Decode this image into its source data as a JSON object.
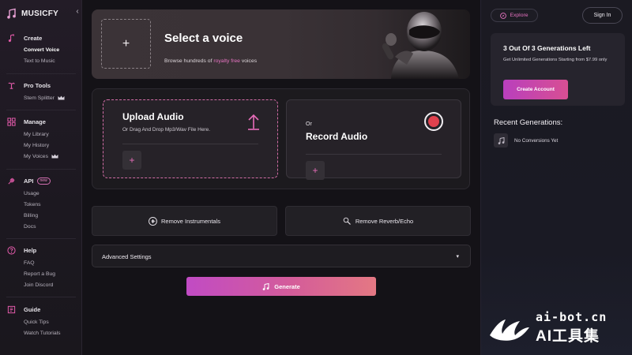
{
  "brand": {
    "name": "MUSICFY",
    "collapse_glyph": "‹"
  },
  "sidebar": {
    "create": {
      "title": "Create",
      "items": [
        {
          "label": "Convert Voice",
          "active": true
        },
        {
          "label": "Text to Music"
        }
      ]
    },
    "pro_tools": {
      "title": "Pro Tools",
      "items": [
        {
          "label": "Stem Splitter",
          "crown": true
        }
      ]
    },
    "manage": {
      "title": "Manage",
      "items": [
        {
          "label": "My Library"
        },
        {
          "label": "My History"
        },
        {
          "label": "My Voices",
          "crown": true
        }
      ]
    },
    "api": {
      "title": "API",
      "badge": "new",
      "items": [
        {
          "label": "Usage"
        },
        {
          "label": "Tokens"
        },
        {
          "label": "Billing"
        },
        {
          "label": "Docs"
        }
      ]
    },
    "help": {
      "title": "Help",
      "items": [
        {
          "label": "FAQ"
        },
        {
          "label": "Report a Bug"
        },
        {
          "label": "Join Discord"
        }
      ]
    },
    "guide": {
      "title": "Guide",
      "items": [
        {
          "label": "Quick Tips"
        },
        {
          "label": "Watch Tutorials"
        }
      ]
    }
  },
  "voice": {
    "plus": "+",
    "title": "Select a voice",
    "sub_before": "Browse hundreds of ",
    "sub_highlight": "royalty free",
    "sub_after": " voices"
  },
  "upload": {
    "title": "Upload Audio",
    "subtitle": "Or Drag And Drop Mp3/Wav File Here.",
    "plus": "+"
  },
  "record": {
    "or": "Or",
    "title": "Record Audio",
    "plus": "+"
  },
  "actions": {
    "remove_instrumentals": "Remove Instrumentals",
    "remove_reverb": "Remove Reverb/Echo"
  },
  "advanced": {
    "label": "Advanced Settings",
    "caret": "▾"
  },
  "generate": {
    "label": "Generate"
  },
  "right": {
    "explore": "Explore",
    "signin": "Sign In",
    "generations": {
      "heading": "3 Out Of 3 Generations Left",
      "text": "Get Unlimited Generations Starting from $7.99 only",
      "button": "Create Account"
    },
    "recent": {
      "heading": "Recent Generations:",
      "empty": "No Conversions Yet"
    }
  },
  "watermark": {
    "line1": "ai-bot.cn",
    "line2": "AI工具集"
  },
  "colors": {
    "accent": "#e66cb9",
    "record": "#e0414e",
    "background": "#141217"
  }
}
